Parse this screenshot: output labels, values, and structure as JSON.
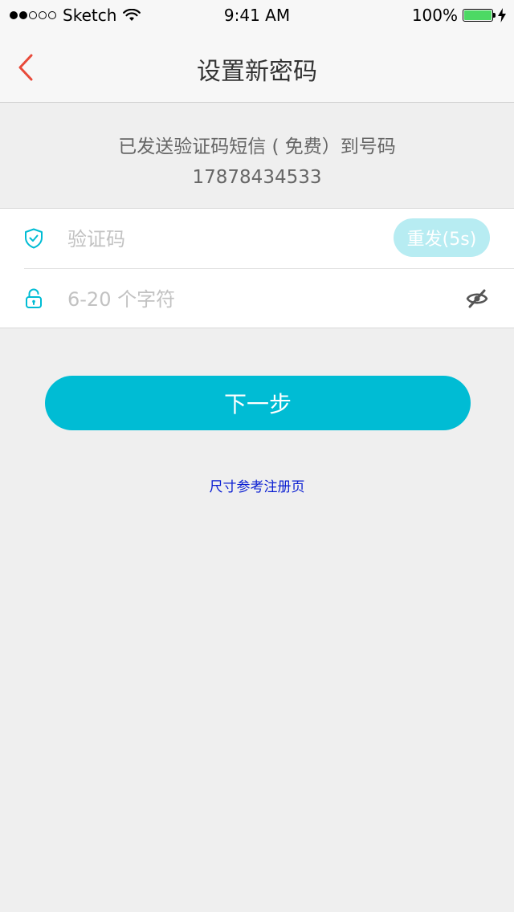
{
  "status_bar": {
    "carrier": "Sketch",
    "time": "9:41 AM",
    "battery_percent": "100%",
    "battery_level": 1.0
  },
  "nav": {
    "title": "设置新密码",
    "back_icon": "chevron-left-icon"
  },
  "info": {
    "line1": "已发送验证码短信 ( 免费）到号码",
    "phone": "17878434533"
  },
  "form": {
    "code_placeholder": "验证码",
    "resend_label": "重发(5s)",
    "password_placeholder": "6-20 个字符"
  },
  "actions": {
    "next_label": "下一步",
    "reference_link": "尺寸参考注册页"
  },
  "colors": {
    "accent": "#00bcd4",
    "resend_disabled": "#b7ecf2",
    "back": "#e84a3a",
    "link": "#0a1ed2"
  }
}
